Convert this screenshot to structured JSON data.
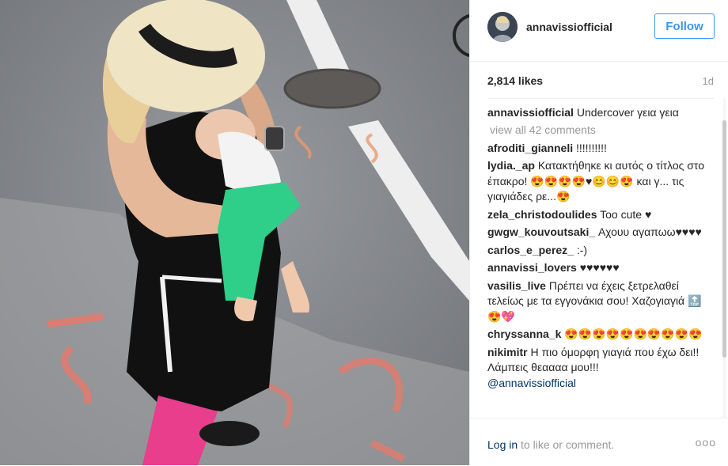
{
  "post": {
    "username": "annavissiofficial",
    "follow_label": "Follow",
    "likes": "2,814 likes",
    "age": "1d",
    "caption_user": "annavissiofficial",
    "caption_text": "Undercover γεια γεια",
    "view_all": "view all 42 comments"
  },
  "comments": [
    {
      "user": "afroditi_gianneli",
      "text": "!!!!!!!!!!"
    },
    {
      "user": "lydia._ap",
      "text": "Κατακτήθηκε κι αυτός ο τίτλος στο έπακρο! 😍😍😍😍♥😊😊😍 και γ... τις γιαγιάδες ρε...😍"
    },
    {
      "user": "zela_christodoulides",
      "text": "Too cute ♥"
    },
    {
      "user": "gwgw_kouvoutsaki_",
      "text": "Αχουυ αγαπωω♥♥♥♥"
    },
    {
      "user": "carlos_e_perez_",
      "text": ":-)"
    },
    {
      "user": "annavissi_lovers",
      "text": "♥♥♥♥♥♥"
    },
    {
      "user": "vasilis_live",
      "text": "Πρέπει να έχεις ξετρελαθεί τελείως με τα εγγονάκια σου! Χαζογιαγιά 🔝😍💖"
    },
    {
      "user": "chryssanna_k",
      "text": "😍😍😍😍😍😍😍😍😍😍"
    },
    {
      "user": "nikimitr",
      "text": "Η πιο όμορφη γιαγιά που έχω δει!! Λάμπεις θεαααα μου!!!"
    }
  ],
  "mention": "@annavissiofficial",
  "footer": {
    "login_link": "Log in",
    "login_rest": " to like or comment.",
    "more": "ooo"
  },
  "colors": {
    "accent": "#3897f0",
    "link": "#003569",
    "muted": "#999999"
  },
  "icons": [
    "avatar-image",
    "more-options-icon"
  ]
}
